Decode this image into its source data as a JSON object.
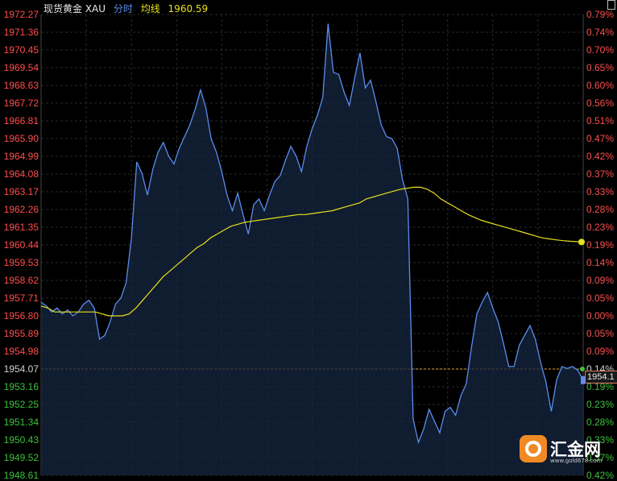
{
  "header": {
    "instrument": "现货黄金 XAU",
    "period": "分时",
    "avg_label": "均线",
    "avg_value": "1960.59"
  },
  "price_tag": "1954.1",
  "logo": {
    "text": "汇金网",
    "url": "www.gold678.com"
  },
  "colors": {
    "background": "#000000",
    "price_line": "#5b8def",
    "avg_line": "#e6e01e",
    "grid": "#2a2a2a",
    "up_text": "#ff4d4d",
    "down_text": "#3ec23e",
    "ref_line": "#e0a030"
  },
  "chart_data": {
    "type": "line",
    "reference_price": 1954.07,
    "ylim": [
      1948.61,
      1972.27
    ],
    "left_ticks": [
      "1972.27",
      "1971.36",
      "1970.45",
      "1969.54",
      "1968.63",
      "1967.72",
      "1966.81",
      "1965.90",
      "1964.99",
      "1964.08",
      "1963.17",
      "1962.26",
      "1961.35",
      "1960.44",
      "1959.53",
      "1958.62",
      "1957.71",
      "1956.80",
      "1955.89",
      "1954.98",
      "1954.07",
      "1953.16",
      "1952.25",
      "1951.34",
      "1950.43",
      "1949.52",
      "1948.61"
    ],
    "right_ticks": [
      "0.79%",
      "0.74%",
      "0.70%",
      "0.65%",
      "0.60%",
      "0.56%",
      "0.51%",
      "0.47%",
      "0.42%",
      "0.37%",
      "0.33%",
      "0.28%",
      "0.23%",
      "0.19%",
      "0.14%",
      "0.09%",
      "0.05%",
      "0.00%",
      "0.05%",
      "0.09%",
      "0.14%",
      "0.19%",
      "0.23%",
      "0.28%",
      "0.33%",
      "0.37%",
      "0.42%"
    ],
    "series": [
      {
        "values": [
          1957.5,
          1957.3,
          1957.0,
          1957.2,
          1956.9,
          1957.1,
          1956.8,
          1957.0,
          1957.4,
          1957.6,
          1957.2,
          1955.6,
          1955.8,
          1956.5,
          1957.4,
          1957.7,
          1958.5,
          1960.8,
          1964.7,
          1964.1,
          1963.0,
          1964.3,
          1965.2,
          1965.7,
          1965.0,
          1964.6,
          1965.4,
          1966.0,
          1966.6,
          1967.4,
          1968.4,
          1967.5,
          1965.9,
          1965.2,
          1964.2,
          1963.0,
          1962.2,
          1963.1,
          1962.0,
          1961.0,
          1962.5,
          1962.8,
          1962.2,
          1963.0,
          1963.7,
          1964.0,
          1964.8,
          1965.5,
          1965.0,
          1964.2,
          1965.5,
          1966.4,
          1967.1,
          1968.0,
          1971.8,
          1969.3,
          1969.2,
          1968.3,
          1967.6,
          1969.0,
          1970.3,
          1968.5,
          1968.9,
          1967.8,
          1966.6,
          1966.0,
          1965.9,
          1965.4,
          1963.8,
          1962.8,
          1951.5,
          1950.3,
          1951.0,
          1952.0,
          1951.4,
          1950.8,
          1951.9,
          1952.1,
          1951.7,
          1952.7,
          1953.3,
          1955.2,
          1956.9,
          1957.5,
          1958.0,
          1957.2,
          1956.5,
          1955.4,
          1954.2,
          1954.2,
          1955.3,
          1955.8,
          1956.3,
          1955.6,
          1954.4,
          1953.4,
          1951.9,
          1953.5,
          1954.2,
          1954.1,
          1954.2,
          1954.0,
          1953.5
        ]
      },
      {
        "values": [
          1957.3,
          1957.2,
          1957.0,
          1957.0,
          1957.0,
          1957.0,
          1957.0,
          1957.0,
          1957.0,
          1956.9,
          1956.8,
          1956.8,
          1956.8,
          1956.9,
          1957.2,
          1957.6,
          1958.0,
          1958.4,
          1958.8,
          1959.1,
          1959.4,
          1959.7,
          1960.0,
          1960.3,
          1960.5,
          1960.8,
          1961.0,
          1961.2,
          1961.4,
          1961.5,
          1961.6,
          1961.65,
          1961.7,
          1961.75,
          1961.8,
          1961.85,
          1961.9,
          1961.95,
          1962.0,
          1962.0,
          1962.05,
          1962.1,
          1962.15,
          1962.2,
          1962.3,
          1962.4,
          1962.5,
          1962.6,
          1962.8,
          1962.9,
          1963.0,
          1963.1,
          1963.2,
          1963.3,
          1963.35,
          1963.4,
          1963.4,
          1963.3,
          1963.1,
          1962.8,
          1962.6,
          1962.4,
          1962.2,
          1962.0,
          1961.85,
          1961.7,
          1961.6,
          1961.5,
          1961.4,
          1961.3,
          1961.2,
          1961.1,
          1961.0,
          1960.9,
          1960.8,
          1960.75,
          1960.7,
          1960.66,
          1960.63,
          1960.61,
          1960.59
        ]
      }
    ]
  }
}
